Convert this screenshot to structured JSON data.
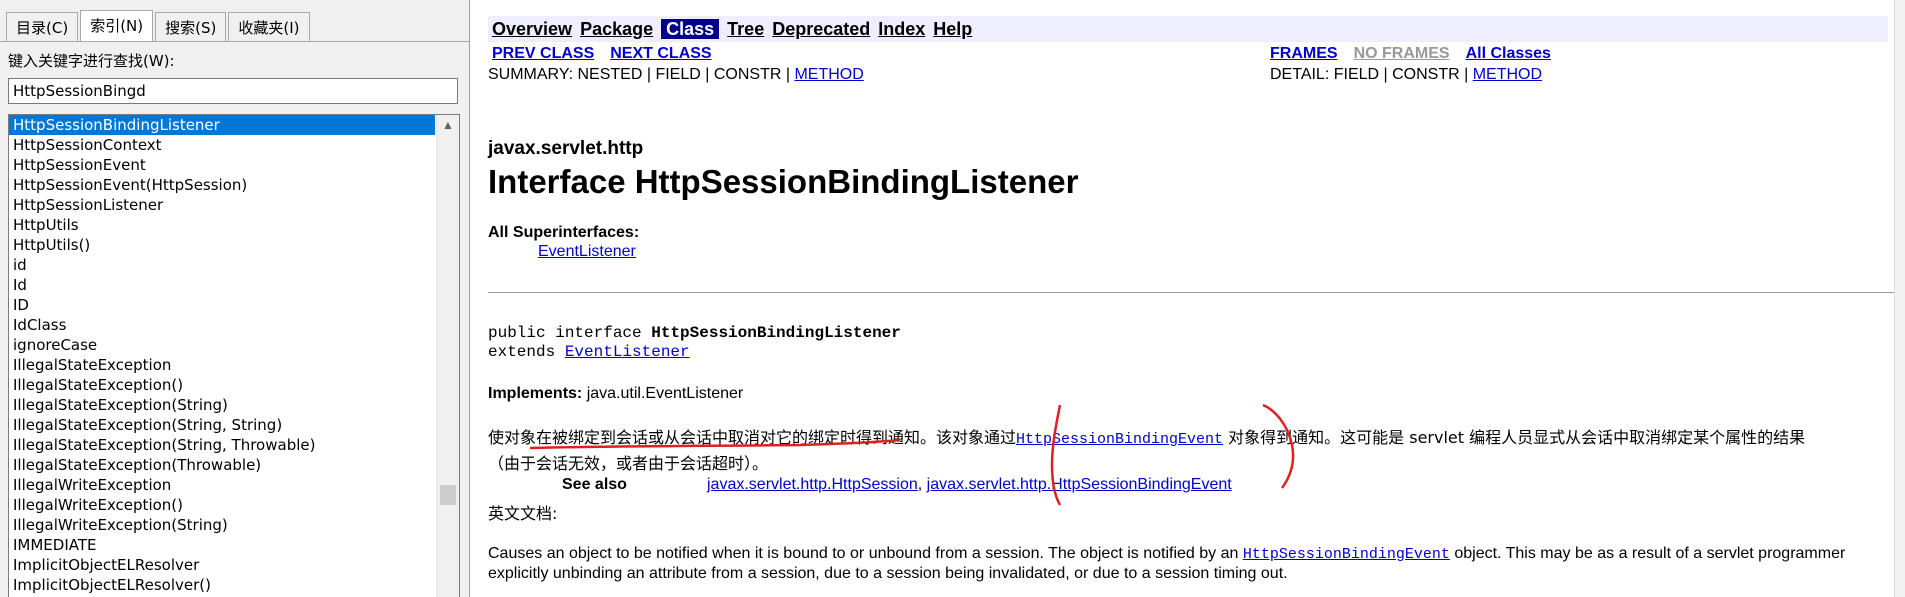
{
  "left_pane": {
    "tabs": [
      "目录(C)",
      "索引(N)",
      "搜索(S)",
      "收藏夹(I)"
    ],
    "active_tab_index": 1,
    "keyword_prompt": "键入关键字进行查找(W):",
    "keyword_value": "HttpSessionBingd",
    "index_items": [
      "HttpSessionBindingListener",
      "HttpSessionContext",
      "HttpSessionEvent",
      "HttpSessionEvent(HttpSession)",
      "HttpSessionListener",
      "HttpUtils",
      "HttpUtils()",
      "id",
      "Id",
      "ID",
      "IdClass",
      "ignoreCase",
      "IllegalStateException",
      "IllegalStateException()",
      "IllegalStateException(String)",
      "IllegalStateException(String, String)",
      "IllegalStateException(String, Throwable)",
      "IllegalStateException(Throwable)",
      "IllegalWriteException",
      "IllegalWriteException()",
      "IllegalWriteException(String)",
      "IMMEDIATE",
      "ImplicitObjectELResolver",
      "ImplicitObjectELResolver()"
    ],
    "selected_index": 0,
    "scroll_up_icon": "▲"
  },
  "content": {
    "nav": {
      "overview": "Overview",
      "package": "Package",
      "class": "Class",
      "tree": "Tree",
      "deprecated": "Deprecated",
      "index": "Index",
      "help": "Help"
    },
    "prev_class": "PREV CLASS",
    "next_class": "NEXT CLASS",
    "frames": "FRAMES",
    "no_frames": "NO FRAMES",
    "all_classes": "All Classes",
    "summary_prefix": "SUMMARY: NESTED | FIELD | CONSTR | ",
    "summary_method": "METHOD",
    "detail_prefix": "DETAIL: FIELD | CONSTR | ",
    "detail_method": "METHOD",
    "package_name": "javax.servlet.http",
    "title": "Interface HttpSessionBindingListener",
    "superinterfaces_label": "All Superinterfaces:",
    "superinterface_link": "EventListener",
    "decl_prefix": "public interface ",
    "decl_name": "HttpSessionBindingListener",
    "extends_prefix": "extends ",
    "extends_link": "EventListener",
    "implements_label": "Implements:",
    "implements_value": " java.util.EventListener",
    "zh_desc_part1": "使对象在被绑定到会话或从会话中取消对它的绑定时得到通知。该对象通过",
    "zh_desc_link": "HttpSessionBindingEvent",
    "zh_desc_part2": "对象得到通知。这可能是 servlet 编程人员显式从会话中取消绑定某个属性的结果",
    "zh_desc_line2": "（由于会话无效，或者由于会话超时）。",
    "see_also_label": "See also",
    "see_also_link1": "javax.servlet.http.HttpSession",
    "see_also_sep": ", ",
    "see_also_link2": "javax.servlet.http.HttpSessionBindingEvent",
    "en_doc_label": "英文文档:",
    "en_line1_a": "Causes an object to be notified when it is bound to or unbound from a session. The object is notified by an ",
    "en_line1_link": "HttpSessionBindingEvent",
    "en_line1_b": " object. This may be as a result of a servlet programmer",
    "en_line2": "explicitly unbinding an attribute from a session, due to a session being invalidated, or due to a session timing out."
  },
  "colors": {
    "selection": "#0078d7",
    "link": "#0000cc",
    "nav_bg": "#eeeeff",
    "nav_current": "#00008b",
    "annotation": "#e02020"
  }
}
